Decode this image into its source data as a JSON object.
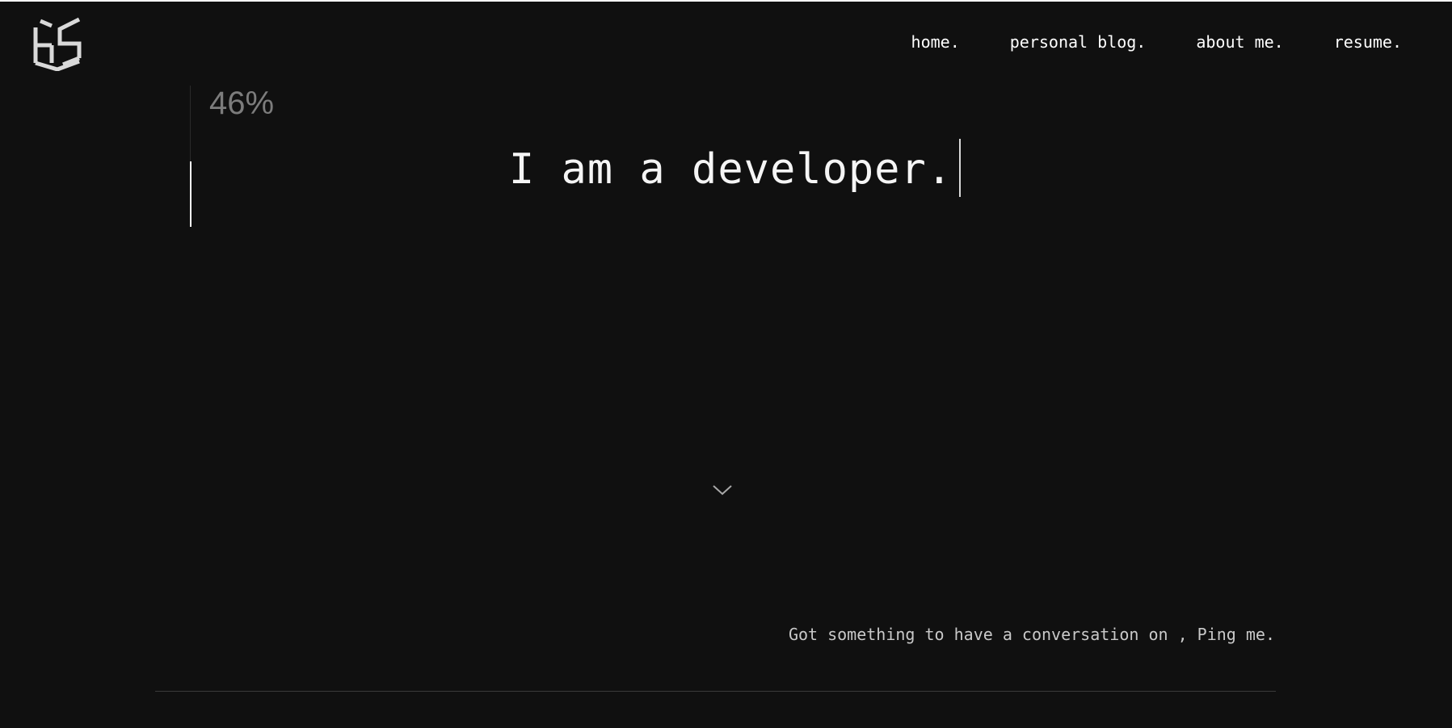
{
  "logo": {
    "icon": "hs-monogram-logo-icon",
    "color": "#d9d9d9"
  },
  "nav": {
    "items": [
      {
        "label": "home."
      },
      {
        "label": "personal blog."
      },
      {
        "label": "about me."
      },
      {
        "label": "resume."
      }
    ]
  },
  "progress": {
    "label": "46%",
    "value": 0.46
  },
  "hero": {
    "text": "I am a developer."
  },
  "scroll": {
    "icon": "chevron-down-icon"
  },
  "contact": {
    "prefix": "Got something to have a conversation on , ",
    "link": "Ping me."
  },
  "colors": {
    "background": "#101010",
    "text": "#ffffff",
    "muted": "#7c7c7c"
  }
}
